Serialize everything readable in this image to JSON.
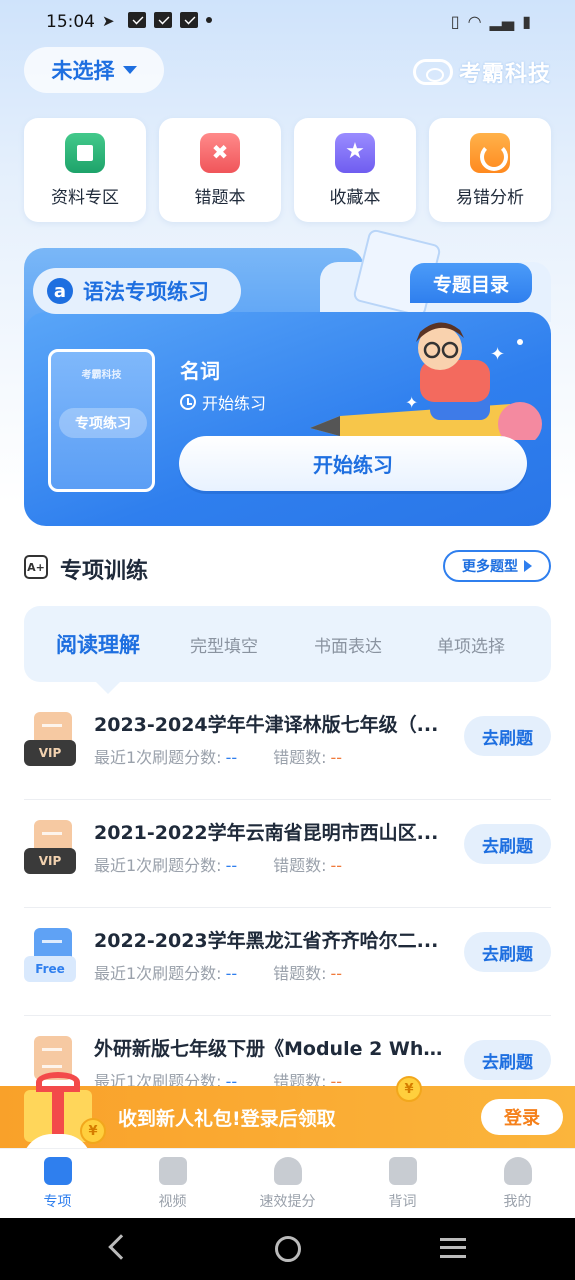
{
  "status_bar": {
    "time": "15:04"
  },
  "header": {
    "select_label": "未选择",
    "brand": "考霸科技"
  },
  "quick_actions": [
    {
      "label": "资料专区",
      "icon": "book-icon"
    },
    {
      "label": "错题本",
      "icon": "wrong-note-icon"
    },
    {
      "label": "收藏本",
      "icon": "favorite-icon"
    },
    {
      "label": "易错分析",
      "icon": "analysis-chart-icon"
    }
  ],
  "grammar": {
    "title": "语法专项练习",
    "a_badge": "a",
    "topic_button": "专题目录",
    "book_brand": "考霸科技",
    "book_tag": "专项练习",
    "lesson_name": "名词",
    "lesson_sub": "开始练习",
    "start_button": "开始练习"
  },
  "section": {
    "title": "专项训练",
    "icon_text": "A+",
    "more_button": "更多题型"
  },
  "tabs": [
    {
      "label": "阅读理解",
      "active": true
    },
    {
      "label": "完型填空",
      "active": false
    },
    {
      "label": "书面表达",
      "active": false
    },
    {
      "label": "单项选择",
      "active": false
    }
  ],
  "list": {
    "score_label": "最近1次刷题分数:",
    "error_label": "错题数:",
    "action_label": "去刷题",
    "items": [
      {
        "title": "2023-2024学年牛津译林版七年级（...",
        "badge": "VIP",
        "score": "--",
        "errors": "--"
      },
      {
        "title": "2021-2022学年云南省昆明市西山区...",
        "badge": "VIP",
        "score": "--",
        "errors": "--"
      },
      {
        "title": "2022-2023学年黑龙江省齐齐哈尔二...",
        "badge": "Free",
        "score": "--",
        "errors": "--"
      },
      {
        "title": "外研新版七年级下册《Module 2 What...",
        "badge": "",
        "score": "--",
        "errors": "--"
      }
    ]
  },
  "promo": {
    "text": "收到新人礼包!登录后领取",
    "button": "登录",
    "coin": "¥"
  },
  "bottom_nav": [
    {
      "label": "专项",
      "active": true
    },
    {
      "label": "视频",
      "active": false
    },
    {
      "label": "速效提分",
      "active": false
    },
    {
      "label": "背词",
      "active": false
    },
    {
      "label": "我的",
      "active": false
    }
  ],
  "colors": {
    "primary": "#2f7fee",
    "accent_orange": "#f9a12a",
    "score": "#2f7fee",
    "errors": "#f07a3b"
  }
}
